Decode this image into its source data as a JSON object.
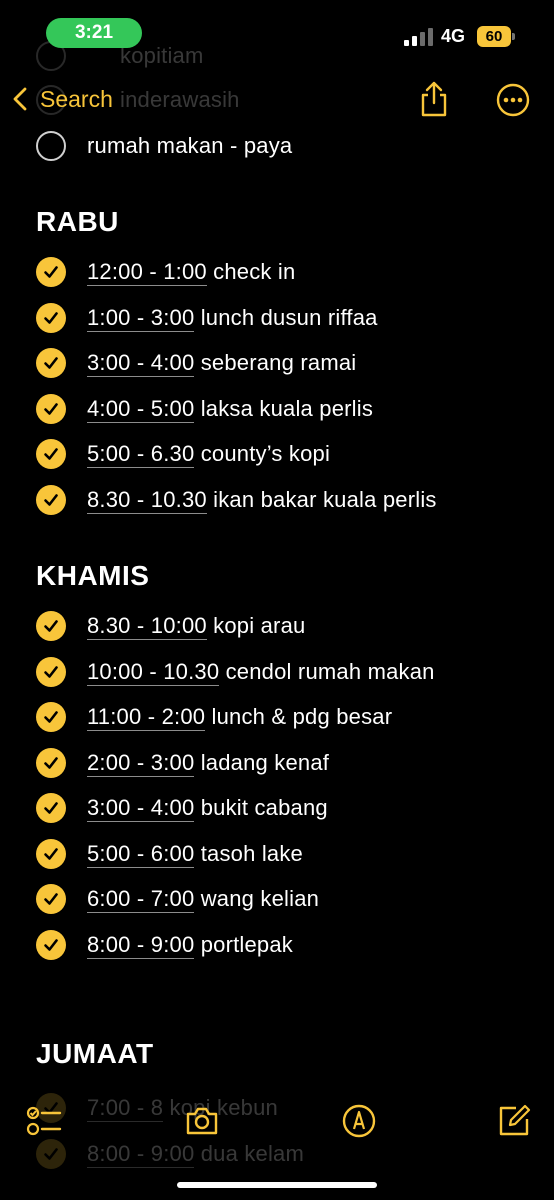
{
  "status_bar": {
    "time": "3:21",
    "network": "4G",
    "battery": "60"
  },
  "nav": {
    "back_label": "Search"
  },
  "scrolled_items": [
    {
      "text": "kopitiam",
      "done": false
    },
    {
      "text": "inderawasih",
      "done": false
    }
  ],
  "top_item": {
    "text": "rumah makan - paya",
    "done": false
  },
  "sections": [
    {
      "heading": "RABU",
      "items": [
        {
          "time": "12:00 - 1:00",
          "text": "check in",
          "done": true
        },
        {
          "time": "1:00 - 3:00",
          "text": "lunch dusun riffaa",
          "done": true
        },
        {
          "time": "3:00 - 4:00",
          "text": "seberang ramai",
          "done": true
        },
        {
          "time": "4:00 - 5:00",
          "text": "laksa kuala perlis",
          "done": true
        },
        {
          "time": "5:00 - 6.30",
          "text": "county’s kopi",
          "done": true
        },
        {
          "time": "8.30 - 10.30",
          "text": "ikan bakar kuala perlis",
          "done": true
        }
      ]
    },
    {
      "heading": "KHAMIS",
      "items": [
        {
          "time": "8.30 - 10:00",
          "text": "kopi arau",
          "done": true
        },
        {
          "time": "10:00 - 10.30",
          "text": "cendol rumah makan",
          "done": true
        },
        {
          "time": "11:00 - 2:00",
          "text": "lunch & pdg besar",
          "done": true
        },
        {
          "time": "2:00 - 3:00",
          "text": "ladang kenaf",
          "done": true
        },
        {
          "time": "3:00 - 4:00",
          "text": "bukit cabang",
          "done": true
        },
        {
          "time": "5:00 - 6:00",
          "text": "tasoh lake",
          "done": true
        },
        {
          "time": "6:00 - 7:00",
          "text": "wang kelian",
          "done": true
        },
        {
          "time": "8:00 - 9:00",
          "text": "portlepak",
          "done": true
        }
      ]
    },
    {
      "heading": "JUMAAT",
      "items": [
        {
          "time": "7:00 - 8",
          "text": "kopi kebun",
          "done": true
        },
        {
          "time": "8:00 - 9:00",
          "text": "dua kelam",
          "done": true
        }
      ]
    }
  ],
  "toolbar": {
    "icons": [
      "checklist-icon",
      "camera-icon",
      "markup-icon",
      "compose-icon"
    ]
  },
  "colors": {
    "accent": "#f8c53a",
    "status_green": "#34c759",
    "background": "#000000"
  }
}
